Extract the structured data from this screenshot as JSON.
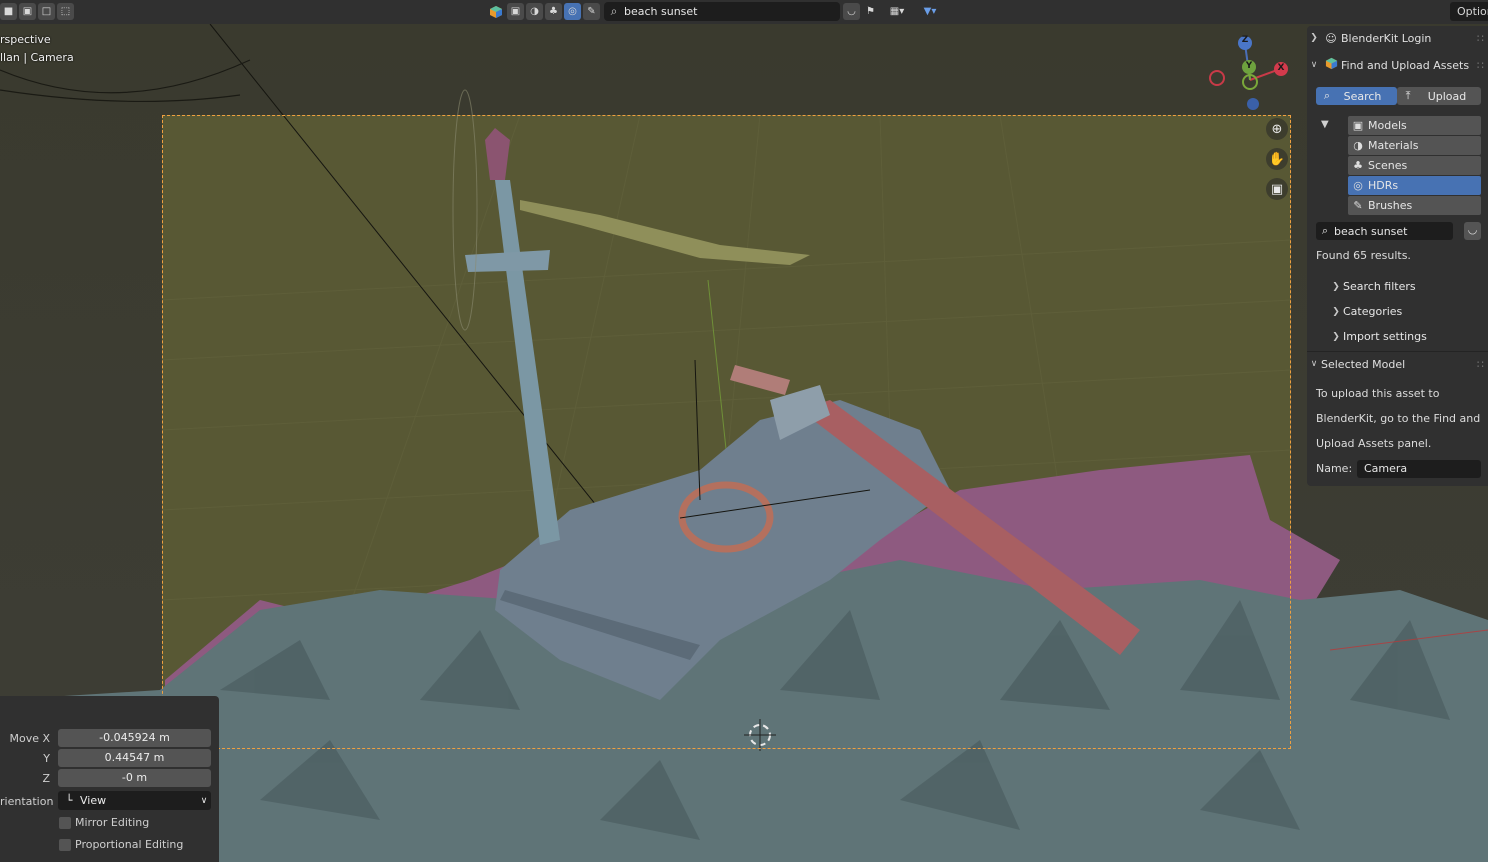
{
  "header": {
    "search_value": "beach sunset",
    "options_label": "Optior"
  },
  "viewport": {
    "view_mode": "rspective",
    "collection": "llan | Camera"
  },
  "gizmo": {
    "axis_z": "Z",
    "axis_y": "Y",
    "axis_x": "X"
  },
  "blenderkit": {
    "login_label": "BlenderKit Login",
    "panel_title": "Find and Upload Assets",
    "tabs": [
      {
        "label": "Search"
      },
      {
        "label": "Upload"
      }
    ],
    "categories": [
      {
        "label": "Models",
        "icon": "cube-icon"
      },
      {
        "label": "Materials",
        "icon": "sphere-icon"
      },
      {
        "label": "Scenes",
        "icon": "scene-icon"
      },
      {
        "label": "HDRs",
        "icon": "world-icon"
      },
      {
        "label": "Brushes",
        "icon": "brush-icon"
      }
    ],
    "active_category": "HDRs",
    "search_value": "beach sunset",
    "results_text": "Found 65 results.",
    "subpanels": [
      {
        "label": "Search filters"
      },
      {
        "label": "Categories"
      },
      {
        "label": "Import settings"
      }
    ],
    "selected_title": "Selected Model",
    "description_lines": [
      "To upload this asset to",
      "BlenderKit, go to the Find and",
      "Upload Assets panel."
    ],
    "name_label": "Name:",
    "name_value": "Camera"
  },
  "redo_panel": {
    "move_x_label": "Move X",
    "move_x_value": "-0.045924 m",
    "y_label": "Y",
    "y_value": "0.44547 m",
    "z_label": "Z",
    "z_value": "-0 m",
    "orientation_label": "rientation",
    "orientation_value": "View",
    "mirror_label": "Mirror Editing",
    "proportional_label": "Proportional Editing"
  },
  "colors": {
    "accent": "#4772b3",
    "camera_frame": "#f0a040",
    "viewport_bg": "#3d3d34"
  }
}
